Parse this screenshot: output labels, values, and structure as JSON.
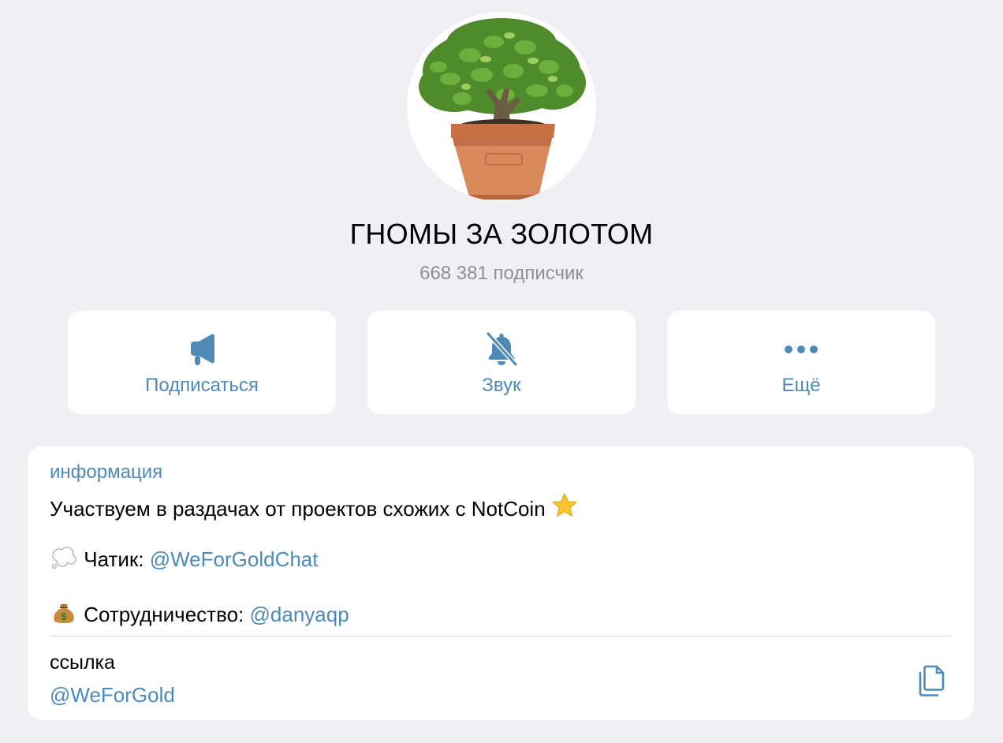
{
  "profile": {
    "title": "ГНОМЫ ЗА ЗОЛОТОМ",
    "subscribers": "668 381 подписчик",
    "avatar_icon": "potted-plant-avatar"
  },
  "actions": [
    {
      "label": "Подписаться",
      "icon": "megaphone-icon"
    },
    {
      "label": "Звук",
      "icon": "bell-slash-icon"
    },
    {
      "label": "Ещё",
      "icon": "more-dots-icon"
    }
  ],
  "info": {
    "section_label": "информация",
    "description": "Участвуем в раздачах от проектов схожих с NotCoin",
    "chat_label": "Чатик:",
    "chat_link": "@WeForGoldChat",
    "collab_label": "Сотрудничество:",
    "collab_link": "@danyaqp",
    "link_label": "ссылка",
    "link_value": "@WeForGold"
  },
  "colors": {
    "background": "#efeff4",
    "card": "#ffffff",
    "accent": "#4e8ab8",
    "secondary_text": "#8e8e93"
  }
}
